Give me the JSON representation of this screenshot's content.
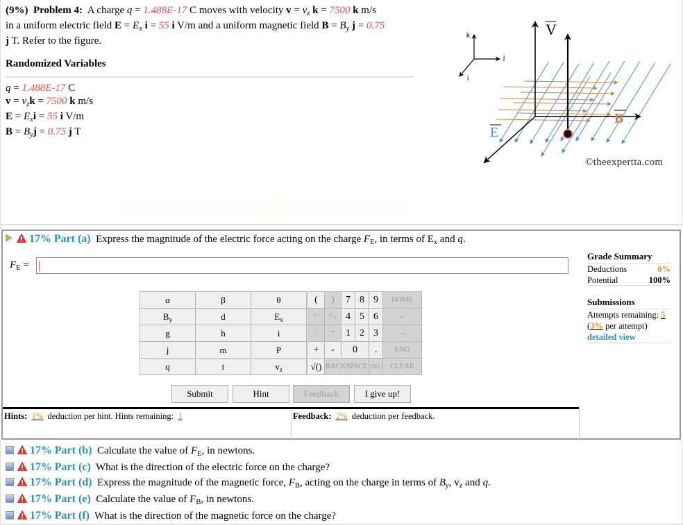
{
  "problem": {
    "percent": "(9%)",
    "title": "Problem 4:",
    "text_1": "A charge",
    "q_sym": "q",
    "eq": "=",
    "q_val": "1.488E-17",
    "q_unit": "C moves with velocity",
    "v_sym": "v",
    "vz_sym": "v",
    "vz_sub": "z",
    "k_sym": "k",
    "v_val": "7500",
    "v_unit": "m/s",
    "text_2": "in a uniform electric field",
    "E_sym": "E",
    "Ex_sym": "E",
    "Ex_sub": "x",
    "i_sym": "i",
    "E_val": "55",
    "E_unit": "V/m and a uniform magnetic field",
    "B_sym": "B",
    "By_sym": "B",
    "By_sub": "y",
    "j_sym": "j",
    "B_val": "0.75",
    "text_3": "T. Refer to the figure."
  },
  "randomized": {
    "title": "Randomized Variables",
    "q_val": "1.488E-17",
    "q_unit": "C",
    "v_val": "7500",
    "v_unit": "m/s",
    "E_val": "55",
    "E_unit": "V/m",
    "B_val": "0.75",
    "B_unit": "T"
  },
  "figure": {
    "axis_k": "k",
    "axis_j": "j",
    "axis_i": "i",
    "label_v": "V",
    "label_b": "B",
    "label_e": "E",
    "copyright": "©theexpertta.com",
    "colors": {
      "E_field": "#4a90c8",
      "B_field": "#c8874a",
      "charge": "#e05030"
    }
  },
  "watermark": "matthewhwang@berkeley.edu",
  "part_a": {
    "percent": "17%",
    "label": "Part (a)",
    "question_1": "Express the magnitude of the electric force acting on the charge",
    "F_sym": "F",
    "F_sub": "E",
    "question_2": ", in terms of E",
    "Ex_sub": "x",
    "question_3": "and",
    "q_sym": "q",
    "period": ".",
    "answer_label_sym": "F",
    "answer_label_sub": "E",
    "answer_label_eq": "=",
    "answer_value": ""
  },
  "grade_summary": {
    "title": "Grade Summary",
    "deductions_label": "Deductions",
    "deductions_value": "0%",
    "potential_label": "Potential",
    "potential_value": "100%"
  },
  "submissions": {
    "title": "Submissions",
    "attempts_label": "Attempts remaining:",
    "attempts_value": "5",
    "per_attempt_value": "3%",
    "per_attempt_label": "per attempt)",
    "open_paren": "(",
    "detailed_view": "detailed view"
  },
  "keypad": {
    "symbols": [
      [
        "α",
        "β",
        "θ"
      ],
      [
        "B_y",
        "d",
        "E_x"
      ],
      [
        "g",
        "h",
        "i"
      ],
      [
        "j",
        "m",
        "P"
      ],
      [
        "q",
        "t",
        "v_z"
      ]
    ],
    "numpad": {
      "open_paren": "(",
      "close_paren": ")",
      "up": "↑^",
      "down": "^↓",
      "divide": "/",
      "multiply": "*",
      "plus": "+",
      "minus": "-",
      "sqrt": "√()",
      "digits": [
        "7",
        "8",
        "9",
        "4",
        "5",
        "6",
        "1",
        "2",
        "3",
        "0"
      ],
      "dot": ".",
      "home": "HOME",
      "left": "←",
      "right": "→",
      "end": "END",
      "backspace": "BACKSPACE",
      "del": "DEL",
      "clear": "CLEAR"
    }
  },
  "buttons": {
    "submit": "Submit",
    "hint": "Hint",
    "feedback": "Feedback",
    "give_up": "I give up!"
  },
  "hints": {
    "label": "Hints:",
    "deduction": "1%",
    "text": "deduction per hint. Hints remaining:",
    "remaining": "1"
  },
  "feedback": {
    "label": "Feedback:",
    "deduction": "2%",
    "text": "deduction per feedback."
  },
  "parts": [
    {
      "percent": "17%",
      "label": "Part (b)",
      "q1": "Calculate the value of",
      "sym": "F",
      "sub": "E",
      "q2": ", in newtons."
    },
    {
      "percent": "17%",
      "label": "Part (c)",
      "q1": "What is the direction of the electric force on the charge?",
      "sym": "",
      "sub": "",
      "q2": ""
    },
    {
      "percent": "17%",
      "label": "Part (d)",
      "q1": "Express the magnitude of the magnetic force,",
      "sym": "F",
      "sub": "B",
      "q2": ", acting on the charge in terms of",
      "extra": {
        "By": "B",
        "By_sub": "y",
        "vz": "v",
        "vz_sub": "z",
        "and": "and",
        "q": "q"
      }
    },
    {
      "percent": "17%",
      "label": "Part (e)",
      "q1": "Calculate the value of",
      "sym": "F",
      "sub": "B",
      "q2": ", in newtons."
    },
    {
      "percent": "17%",
      "label": "Part (f)",
      "q1": "What is the direction of the magnetic force on the charge?",
      "sym": "",
      "sub": "",
      "q2": ""
    }
  ]
}
